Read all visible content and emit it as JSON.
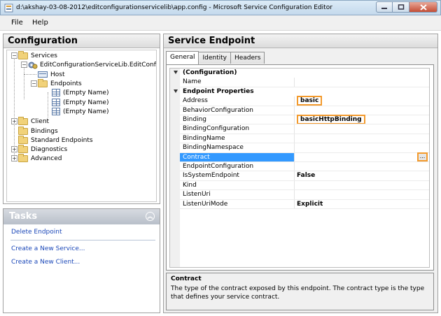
{
  "window": {
    "title": "d:\\akshay-03-08-2012\\editconfigurationservicelib\\app.config - Microsoft Service Configuration Editor"
  },
  "menu": {
    "file": "File",
    "help": "Help"
  },
  "left": {
    "header": "Configuration",
    "tree": {
      "services": "Services",
      "service": "EditConfigurationServiceLib.EditConfigura",
      "host": "Host",
      "endpoints": "Endpoints",
      "empty1": "(Empty Name)",
      "empty2": "(Empty Name)",
      "empty3": "(Empty Name)",
      "client": "Client",
      "bindings": "Bindings",
      "standard_endpoints": "Standard Endpoints",
      "diagnostics": "Diagnostics",
      "advanced": "Advanced"
    }
  },
  "tasks": {
    "header": "Tasks",
    "delete_endpoint": "Delete Endpoint",
    "new_service": "Create a New Service...",
    "new_client": "Create a New Client..."
  },
  "right": {
    "header": "Service Endpoint",
    "tabs": {
      "general": "General",
      "identity": "Identity",
      "headers": "Headers"
    },
    "props": {
      "cat_configuration": "(Configuration)",
      "name": "Name",
      "cat_endpoint": "Endpoint Properties",
      "address": "Address",
      "address_val": "basic",
      "behavior_configuration": "BehaviorConfiguration",
      "binding": "Binding",
      "binding_val": "basicHttpBinding",
      "binding_configuration": "BindingConfiguration",
      "binding_name": "BindingName",
      "binding_namespace": "BindingNamespace",
      "contract": "Contract",
      "endpoint_configuration": "EndpointConfiguration",
      "is_system_endpoint": "IsSystemEndpoint",
      "is_system_endpoint_val": "False",
      "kind": "Kind",
      "listen_uri": "ListenUri",
      "listen_uri_mode": "ListenUriMode",
      "listen_uri_mode_val": "Explicit",
      "ellipsis": "..."
    },
    "description": {
      "title": "Contract",
      "text": "The type of the contract exposed by this endpoint. The contract type is the type that defines your service contract."
    }
  },
  "colors": {
    "highlight": "#f39a2c",
    "selection": "#3399ff",
    "link": "#1a47b8"
  }
}
